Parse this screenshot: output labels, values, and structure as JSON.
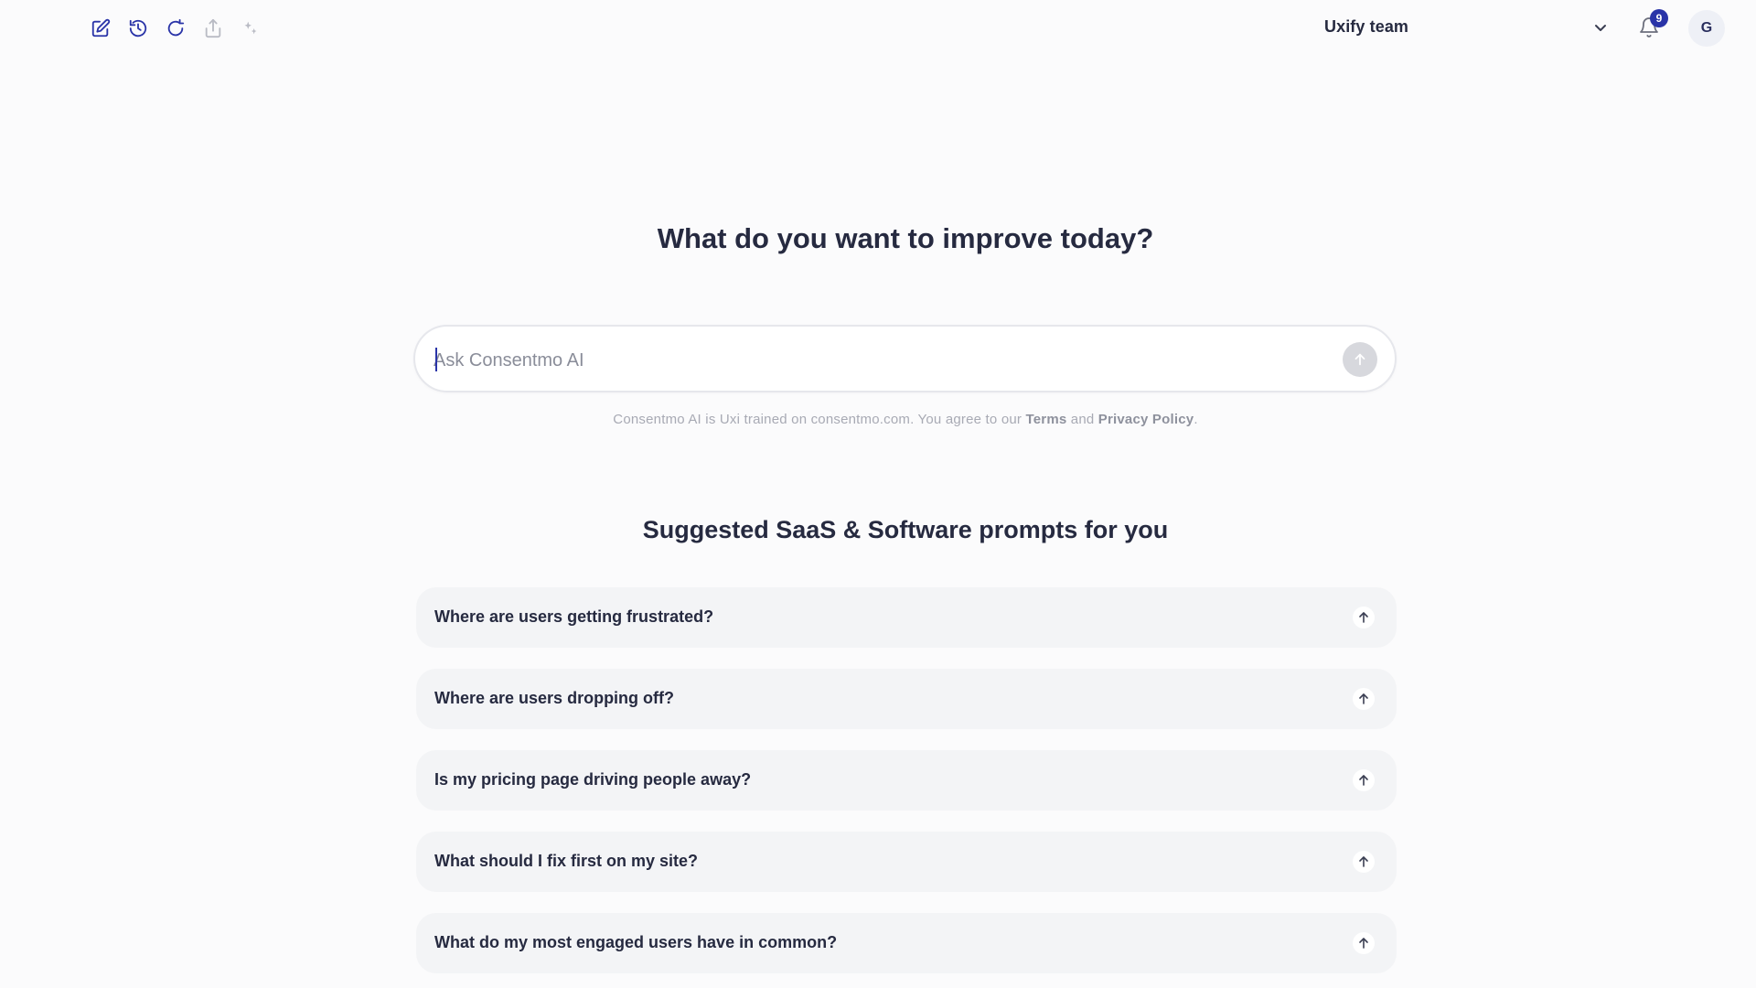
{
  "toolbar": {
    "icons": [
      "edit-icon",
      "history-icon",
      "refresh-icon",
      "share-icon",
      "sparkle-icon"
    ]
  },
  "header": {
    "team_name": "Uxify team",
    "notification_count": "9",
    "avatar_initial": "G"
  },
  "main": {
    "headline": "What do you want to improve today?",
    "search": {
      "placeholder": "Ask Consentmo AI",
      "value": ""
    },
    "disclaimer": {
      "prefix": "Consentmo AI is Uxi trained on consentmo.com. You agree to our ",
      "terms_label": "Terms",
      "and": " and ",
      "privacy_label": "Privacy Policy",
      "suffix": "."
    },
    "suggestions_title": "Suggested SaaS & Software prompts for you",
    "prompts": [
      "Where are users getting frustrated?",
      "Where are users dropping off?",
      "Is my pricing page driving people away?",
      "What should I fix first on my site?",
      "What do my most engaged users have in common?"
    ]
  },
  "colors": {
    "accent": "#2a34a8",
    "text": "#262a40",
    "muted": "#a8aab4",
    "card": "#f3f4f6",
    "background": "#fbfbfc"
  }
}
